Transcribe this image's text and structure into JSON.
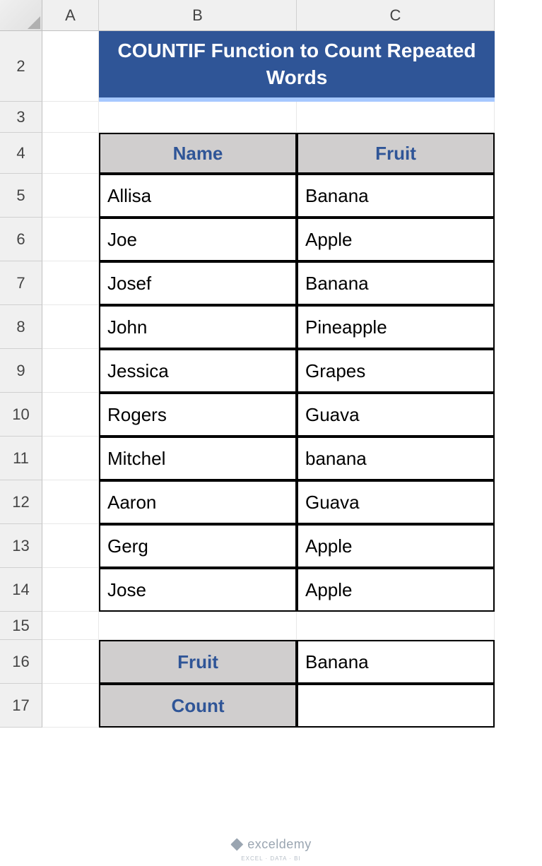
{
  "columns": [
    "A",
    "B",
    "C"
  ],
  "rows": [
    "2",
    "3",
    "4",
    "5",
    "6",
    "7",
    "8",
    "9",
    "10",
    "11",
    "12",
    "13",
    "14",
    "15",
    "16",
    "17"
  ],
  "title": "COUNTIF Function to Count Repeated Words",
  "table": {
    "headers": {
      "name": "Name",
      "fruit": "Fruit"
    },
    "rows": [
      {
        "name": "Allisa",
        "fruit": "Banana"
      },
      {
        "name": "Joe",
        "fruit": "Apple"
      },
      {
        "name": "Josef",
        "fruit": "Banana"
      },
      {
        "name": "John",
        "fruit": "Pineapple"
      },
      {
        "name": "Jessica",
        "fruit": "Grapes"
      },
      {
        "name": "Rogers",
        "fruit": "Guava"
      },
      {
        "name": "Mitchel",
        "fruit": "banana"
      },
      {
        "name": "Aaron",
        "fruit": "Guava"
      },
      {
        "name": "Gerg",
        "fruit": "Apple"
      },
      {
        "name": "Jose",
        "fruit": "Apple"
      }
    ]
  },
  "summary": {
    "fruit_label": "Fruit",
    "fruit_value": "Banana",
    "count_label": "Count",
    "count_value": ""
  },
  "watermark": {
    "brand": "exceldemy",
    "tag": "EXCEL · DATA · BI"
  }
}
